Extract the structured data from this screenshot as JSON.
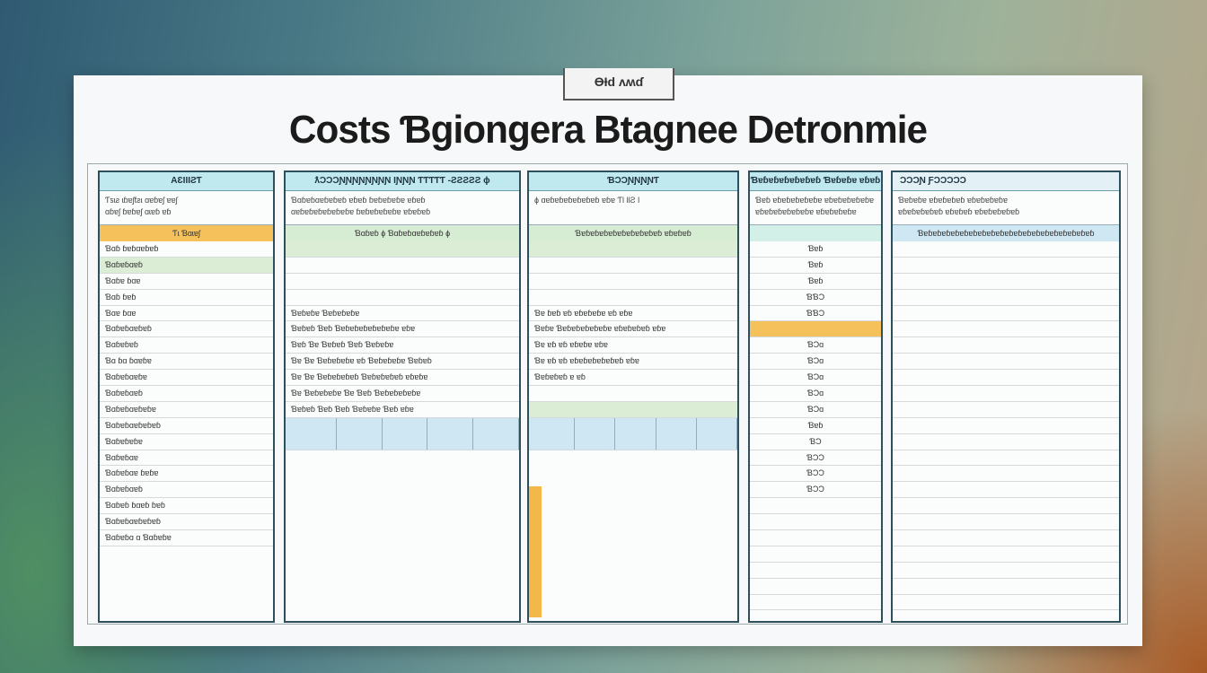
{
  "sheet": {
    "stamp": "ƟƗd ʌʍɗ",
    "title": "Costs Ɓgiongera Btagnee Detronmie"
  },
  "panels": [
    {
      "header": "AƐƖƖƖƧƬ",
      "sub": [
        "Ƭƽɩƨ ɩɓɐʃƭƨɩ ɑɐɓɐʃ ɐɐʃ",
        "ɑɓɐʃ ɓɐɓɐʃ ɑɩɐɓ ɐɓ"
      ],
      "band": "Ƭɩ Ɓɑɩɐʃ",
      "rows": [
        "Ɓɑɓ ɓɐɓɑɐɓɐɓ",
        "Ɓɑɓɐɓɑɐɓ",
        "Ɓɑɓɐ ɓɑɐ",
        "Ɓɑɓ ɓɐɓ",
        "Ɓɑɐ ɓɑɐ",
        "Ɓɑɓɐɓɑɐɓɐɓ",
        "Ɓɑɓɐɓɐɓ",
        "Ɓɑ ɓɑ ɓɑɐɓɐ",
        "Ɓɑɓɐɓɑɐɓɐ",
        "Ɓɑɓɐɓɑɐɓ",
        "Ɓɑɓɐɓɑɐɓɐɓɐ",
        "Ɓɑɓɐɓɑɐɓɐɓɐɓ",
        "Ɓɑɓɐɓɐɓɐ",
        "Ɓɑɓɐɓɑɐ",
        "Ɓɑɓɐɓɑɐ ɓɐɓɐ",
        "Ɓɑɓɐɓɑɐɓ",
        "Ɓɑɓɐɓ ɓɑɐɓ ɓɐɓ",
        "Ɓɑɓɐɓɑɐɓɐɓɐɓ",
        "Ɓɑɓɐɓɑ ɑ Ɓɑɓɐɓɐ"
      ]
    },
    {
      "header": "ƛƆƆƆƝƝƝƝƝƝƝƝ   ƖƝƝƝ ƬƬƬƬƬ -ƧƧƧƧƧ ɸ",
      "sub": [
        "Ɓɑɓɐɓɑɐɓɐɓɐɓ ɐɓɐɓ ɓɐɓɐɓɐɓɐ ɐɓɐɓ",
        "ɑɐɓɐɓɐɓɐɓɐɓɐɓɐ ɓɐɓɐɓɐɓɐɓɐ ɐɓɐɓɐɓ"
      ],
      "band": "Ɓɑɓɐɓ    ɸ   Ɓɑɓɐɓɑɐɓɐɓɐɓ   ɸ",
      "rows": [
        "",
        "",
        "",
        "",
        "Ɓɐɓɐɓɐ Ɓɐɓɐɓɐɓɐ",
        "Ɓɐɓɐɓ Ɓɐɓ Ɓɐɓɐɓɐɓɐɓɐɓɐɓɐ ɐɓɐ",
        "Ɓɐɓ Ɓɐ Ɓɐɓɐɓ Ɓɐɓ Ɓɐɓɐɓɐ",
        "Ɓɐ Ɓɐ Ɓɐɓɐɓɐɓɐ ɐɓ Ɓɐɓɐɓɐɓɐ Ɓɐɓɐɓ",
        "Ɓɐ Ɓɐ Ɓɐɓɐɓɐɓɐɓ Ɓɐɓɐɓɐɓɐɓ ɐɓɐɓɐ",
        "Ɓɐ Ɓɐɓɐɓɐɓɐ Ɓɐ Ɓɐɓ Ɓɐɓɐɓɐɓɐɓɐ",
        "Ɓɐɓɐɓ Ɓɐɓ Ɓɐɓ Ɓɐɓɐɓɐ Ɓɐɓ ɐɓɐ"
      ]
    },
    {
      "header": "ƁƆƆƝƝƝƝƬ",
      "sub": [
        "ɸ  ɑɐɓɐɓɐɓɐɓɐɓɐɓ ɐɓɐ  ƬƖ ƖƖƧ  ǀ",
        "ɸ"
      ],
      "band": "Ɓɐɓɐɓɐɓɐɓɐɓɐɓɐɓɐɓɐɓ ɐɓɐɓɐɓ",
      "rows": [
        "",
        "",
        "",
        "",
        "Ɓɐ ɓɐɓ ɐɓ ɐɓɐɓɐɓɐ ɐɓ ɐɓɐ",
        "Ɓɐɓɐ Ɓɐɓɐɓɐɓɐɓɐɓɐ ɐɓɐɓɐɓɐɓ ɐɓɐ",
        "Ɓɐ ɐɓ ɐɓ ɐɓɐɓɐ ɐɓɐ",
        "Ɓɐ ɐɓ ɐɓ ɐɓɐɓɐɓɐɓɐɓɐɓ ɐɓɐ",
        "Ɓɐɓɐɓɐɓ ɐ ɐɓ",
        ""
      ]
    },
    {
      "header": "Ɓɐɓɐɓɐɓɐɓɐɓɐɓ Ɓɐɓɐɓɐ ɐɓɐɓ",
      "sub": [
        "Ɓɐɓ ɐɓɐɓɐɓɐɓɐɓɐ ɐɓɐɓɐɓɐɓɐɓɐ",
        "ɐɓɐɓɐɓɐɓɐɓɐɓɐ ɐɓɐɓɐɓɐɓɐ"
      ],
      "rows": [
        "Ɓɐɓ",
        "Ɓɐɓ",
        "Ɓɐɓ",
        "ƁƁƆ",
        "ƁƁƆ",
        "",
        "ƁƆɑ",
        "ƁƆɑ",
        "ƁƆɑ",
        "ƁƆɑ",
        "ƁƆɑ",
        "Ɓɐɓ",
        "ƁƆ",
        "ƁƆƆ",
        "ƁƆƆ",
        "ƁƆƆ"
      ]
    },
    {
      "header": "ƆƆƆƝ   ƑƆƆƆƆƆ",
      "sub": [
        "Ɓɐɓɐɓɐ ɐɓɐɓɐɓɐɓ    ɐɓɐɓɐɓɐɓɐ",
        "ɐɓɐɓɐɓɐɓɐɓ ɐɓɐɓɐɓ  ɐɓɐɓɐɓɐɓɐɓ"
      ],
      "band": "Ɓɐɓɐɓɐɓɐɓɐɓɐɓɐɓɐɓɐɓɐɓɐɓɐɓɐɓɐɓɐɓɐɓɐɓɐɓɐɓ"
    }
  ],
  "colors": {
    "header": "#bfe8ef",
    "green": "#dbedd5",
    "orange": "#f4c15a",
    "blue": "#cfe6f3"
  }
}
